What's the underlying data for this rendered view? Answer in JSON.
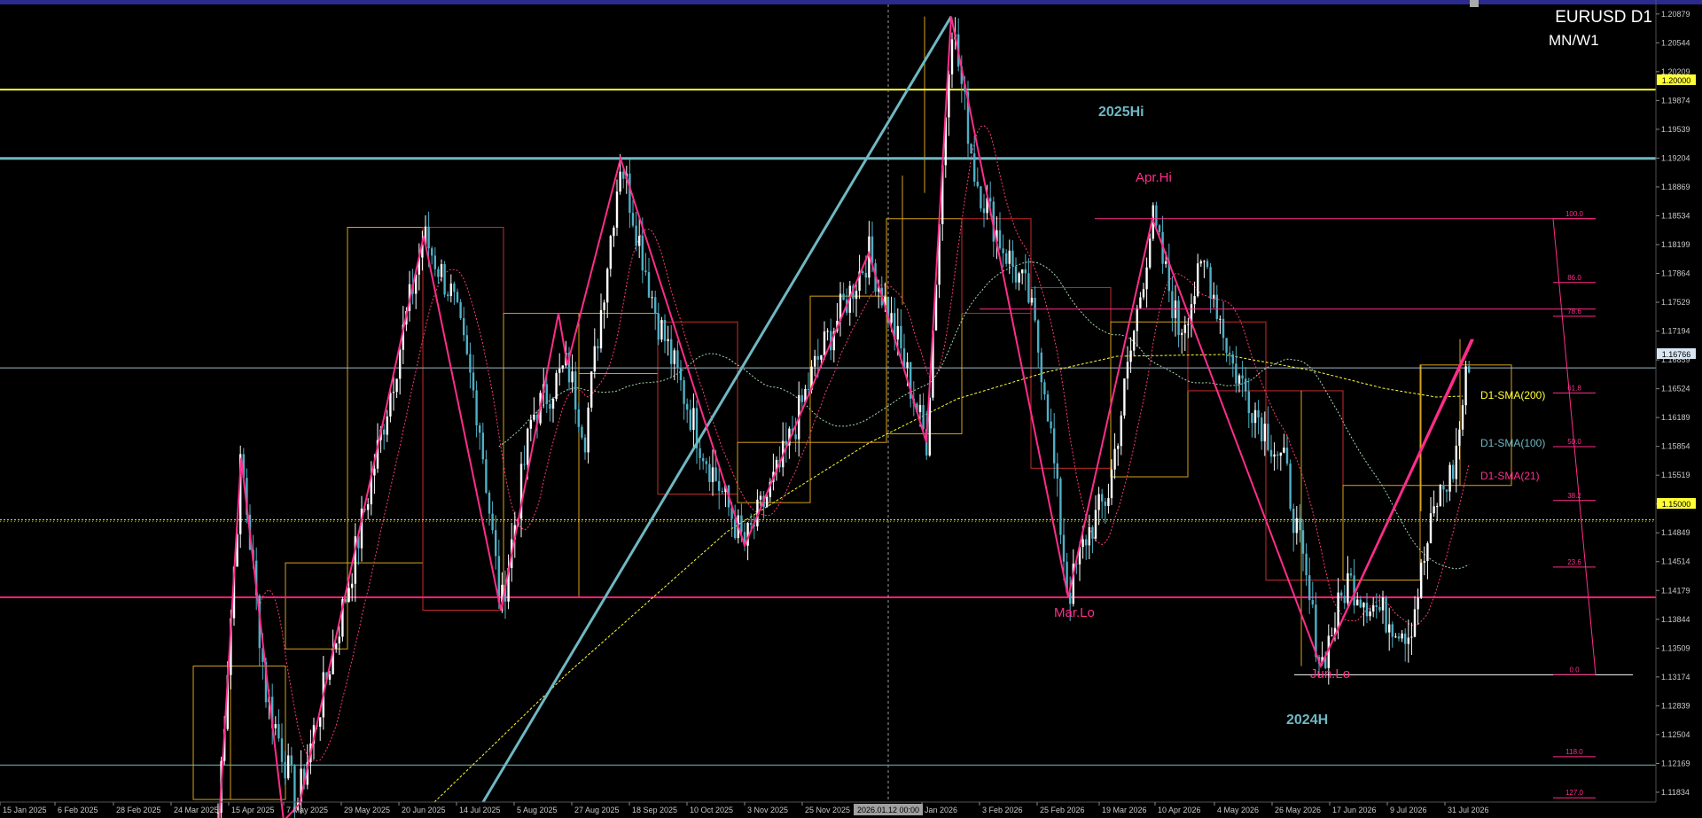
{
  "header": {
    "symbol": "EURUSD D1",
    "timeframes": "MN/W1"
  },
  "crosshair": {
    "time_label": "2026.01.12 00:00"
  },
  "annotations": {
    "hi_2025": "2025Hi",
    "apr_hi": "Apr.Hi",
    "mar_lo": "Mar.Lo",
    "jun_lo": "Jun.Lo",
    "h_2024": "2024H"
  },
  "legend": {
    "sma200": "D1-SMA(200)",
    "sma100": "D1-SMA(100)",
    "sma21": "D1-SMA(21)"
  },
  "price_tags": {
    "round_high": "1.20000",
    "current": "1.16766",
    "round_low": "1.15000"
  },
  "fib_levels": [
    "100.0",
    "86.0",
    "78.6",
    "61.8",
    "50.0",
    "38.2",
    "23.6",
    "0.0",
    "118.0",
    "127.0"
  ],
  "colors": {
    "background": "#000000",
    "bull_candle": "#ffffff",
    "bear_candle": "#4fb0c6",
    "zigzag": "#ff2d8a",
    "yellow_line": "#ffff33",
    "teal_line": "#6fb8c2",
    "pink_line": "#ff1f7a",
    "box_yellow": "#d7a21c",
    "box_red": "#c62b2b",
    "sma200": "#ffff33",
    "sma100": "#a8d8b0",
    "sma21": "#ff3b6e",
    "axis_text": "#c8c8c8"
  },
  "chart_data": {
    "type": "candlestick",
    "symbol": "EURUSD",
    "timeframe": "D1",
    "x_tick_labels": [
      "15 Jan 2025",
      "6 Feb 2025",
      "28 Feb 2025",
      "24 Mar 2025",
      "15 Apr 2025",
      "7 May 2025",
      "29 May 2025",
      "20 Jun 2025",
      "14 Jul 2025",
      "5 Aug 2025",
      "27 Aug 2025",
      "18 Sep 2025",
      "10 Oct 2025",
      "3 Nov 2025",
      "25 Nov 2025",
      "2026.01.12 00:00",
      "Jan 2026",
      "3 Feb 2026",
      "25 Feb 2026",
      "19 Mar 2026",
      "10 Apr 2026",
      "4 May 2026",
      "26 May 2026",
      "17 Jun 2026",
      "9 Jul 2026",
      "31 Jul 2026"
    ],
    "y_tick_labels": [
      "1.20879",
      "1.20544",
      "1.20209",
      "1.19874",
      "1.19539",
      "1.19204",
      "1.18869",
      "1.18534",
      "1.18199",
      "1.17864",
      "1.17529",
      "1.17194",
      "1.16859",
      "1.16524",
      "1.16189",
      "1.15854",
      "1.15519",
      "1.15184",
      "1.14849",
      "1.14514",
      "1.14179",
      "1.13844",
      "1.13509",
      "1.13174",
      "1.12839",
      "1.12504",
      "1.12169",
      "1.11834"
    ],
    "ylim": [
      1.1172,
      1.2098
    ],
    "horizontal_levels": [
      1.2,
      1.192,
      1.16766,
      1.15,
      1.141,
      1.1215
    ],
    "key_points": [
      {
        "x": "15 Apr 2025",
        "y": 1.1572
      },
      {
        "x": "7 May 2025",
        "y": 1.117
      },
      {
        "x": "20 Jun 2025",
        "y": 1.183
      },
      {
        "x": "14 Jul 2025",
        "y": 1.1395
      },
      {
        "x": "18 Sep 2025",
        "y": 1.192
      },
      {
        "x": "3 Nov 2025",
        "y": 1.147
      },
      {
        "x": "25 Nov 2025",
        "y": 1.181
      },
      {
        "x": "Jan 2026",
        "y": 1.158
      },
      {
        "x": "Jan 2026",
        "y": 1.2085
      },
      {
        "x": "25 Feb 2026",
        "y": 1.169
      },
      {
        "x": "19 Mar 2026",
        "y": 1.141
      },
      {
        "x": "10 Apr 2026",
        "y": 1.185
      },
      {
        "x": "17 Jun 2026",
        "y": 1.132
      },
      {
        "x": "31 Jul 2026",
        "y": 1.171
      }
    ],
    "series": [
      {
        "name": "D1-SMA(200)",
        "values": [
          1.118,
          1.125,
          1.138,
          1.148,
          1.156,
          1.164,
          1.1675,
          1.1668,
          1.163,
          1.162
        ]
      },
      {
        "name": "D1-SMA(100)",
        "values": [
          1.142,
          1.157,
          1.164,
          1.166,
          1.168,
          1.17,
          1.17,
          1.167,
          1.158,
          1.159
        ]
      },
      {
        "name": "D1-SMA(21)",
        "values": [
          1.123,
          1.16,
          1.17,
          1.155,
          1.182,
          1.17,
          1.148,
          1.166,
          1.148,
          1.138,
          1.152
        ]
      }
    ]
  }
}
